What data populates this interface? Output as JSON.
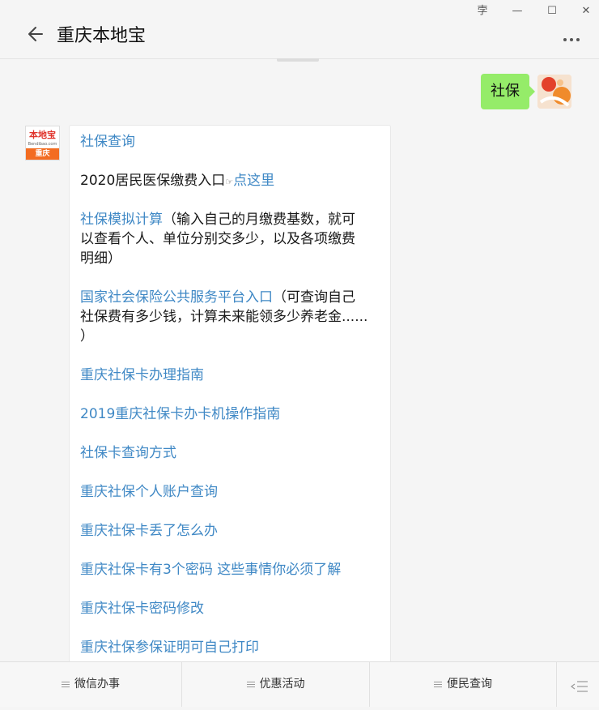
{
  "window": {
    "pin_glyph": "孛",
    "minimize_glyph": "—",
    "maximize_glyph": "☐",
    "close_glyph": "✕"
  },
  "header": {
    "title": "重庆本地宝",
    "back_icon": "back-arrow-icon",
    "more_icon": "more-dots-icon"
  },
  "chat": {
    "user_message": "社保",
    "bot_avatar": {
      "logo_text": "本地宝",
      "logo_sub": "Bendibao.com",
      "city": "重庆"
    },
    "reply": {
      "line1": "社保查询",
      "line2_plain": "2020居民医保缴费入口",
      "line2_hand": "☞",
      "line2_link": "点这里",
      "line3_link": "社保模拟计算",
      "line3_plain": "（输入自己的月缴费基数，就可",
      "line4": "以查看个人、单位分别交多少，以及各项缴费",
      "line5": "明细）",
      "line6_link": "国家社会保险公共服务平台入口",
      "line6_plain": "（可查询自己",
      "line7": "社保费有多少钱，计算未来能领多少养老金......",
      "line8": "）",
      "links": [
        "重庆社保卡办理指南",
        "2019重庆社保卡办卡机操作指南",
        "社保卡查询方式",
        "重庆社保个人账户查询",
        "重庆社保卡丢了怎么办",
        "重庆社保卡有3个密码 这些事情你必须了解",
        "重庆社保卡密码修改",
        "重庆社保参保证明可自己打印"
      ]
    }
  },
  "bottom_menu": {
    "items": [
      "微信办事",
      "优惠活动",
      "便民查询"
    ],
    "keyboard_icon": "keyboard-toggle-icon"
  },
  "colors": {
    "link": "#3f88c5",
    "user_bubble": "#95ec69",
    "logo_orange": "#f36c21",
    "logo_red": "#e0322a"
  }
}
